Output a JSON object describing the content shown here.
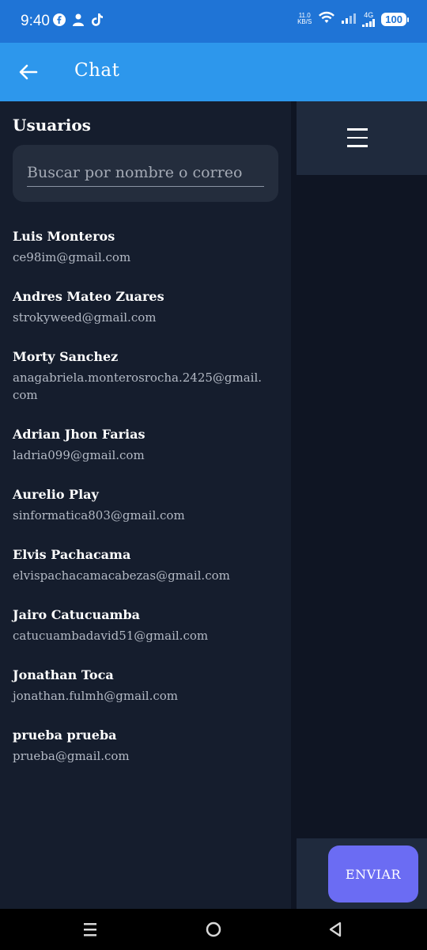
{
  "status_bar": {
    "time": "9:40",
    "net_speed_top": "11.0",
    "net_speed_bottom": "KB/S",
    "network_type": "4G",
    "battery": "100"
  },
  "app_bar": {
    "title": "Chat"
  },
  "users_panel": {
    "title": "Usuarios",
    "search_placeholder": "Buscar por nombre o correo",
    "users": [
      {
        "name": "Luis Monteros",
        "email": "ce98im@gmail.com"
      },
      {
        "name": "Andres Mateo Zuares",
        "email": "strokyweed@gmail.com"
      },
      {
        "name": "Morty Sanchez",
        "email": "anagabriela.monterosrocha.2425@gmail.com"
      },
      {
        "name": "Adrian Jhon Farias",
        "email": "ladria099@gmail.com"
      },
      {
        "name": "Aurelio Play",
        "email": "sinformatica803@gmail.com"
      },
      {
        "name": "Elvis Pachacama",
        "email": "elvispachacamacabezas@gmail.com"
      },
      {
        "name": "Jairo Catucuamba",
        "email": "catucuambadavid51@gmail.com"
      },
      {
        "name": "Jonathan Toca",
        "email": "jonathan.fulmh@gmail.com"
      },
      {
        "name": "prueba prueba",
        "email": "prueba@gmail.com"
      }
    ]
  },
  "chat_panel": {
    "send_label": "ENVIAR"
  },
  "colors": {
    "status_bar": "#1f74d6",
    "app_bar": "#2d97ec",
    "panel_bg": "#151d2d",
    "send_button": "#6b6cf3"
  },
  "icons": {
    "back": "arrow-left-icon",
    "menu": "hamburger-menu-icon",
    "nav_recents": "recents-icon",
    "nav_home": "home-icon",
    "nav_back": "triangle-back-icon"
  }
}
